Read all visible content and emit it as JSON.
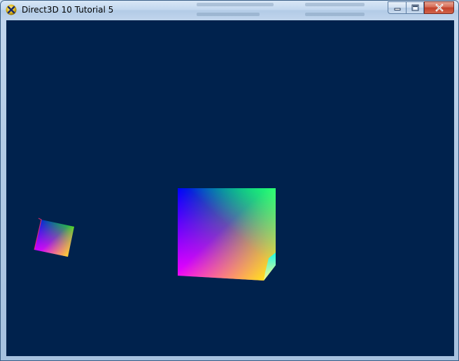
{
  "window": {
    "title": "Direct3D 10 Tutorial 5",
    "app_icon": "directx-x-icon",
    "clear_color": "#00224d"
  },
  "caption_buttons": {
    "minimize_icon": "minimize-icon",
    "maximize_icon": "maximize-icon",
    "close_icon": "close-icon"
  },
  "scene": {
    "objects": [
      {
        "name": "central-cube",
        "colors": [
          "#0000ff",
          "#00ff00",
          "#ff00ff",
          "#ffff00",
          "#00ffff"
        ]
      },
      {
        "name": "orbiting-cube",
        "colors": [
          "#0000ff",
          "#00ff00",
          "#ff00ff",
          "#ffff00"
        ]
      }
    ]
  }
}
